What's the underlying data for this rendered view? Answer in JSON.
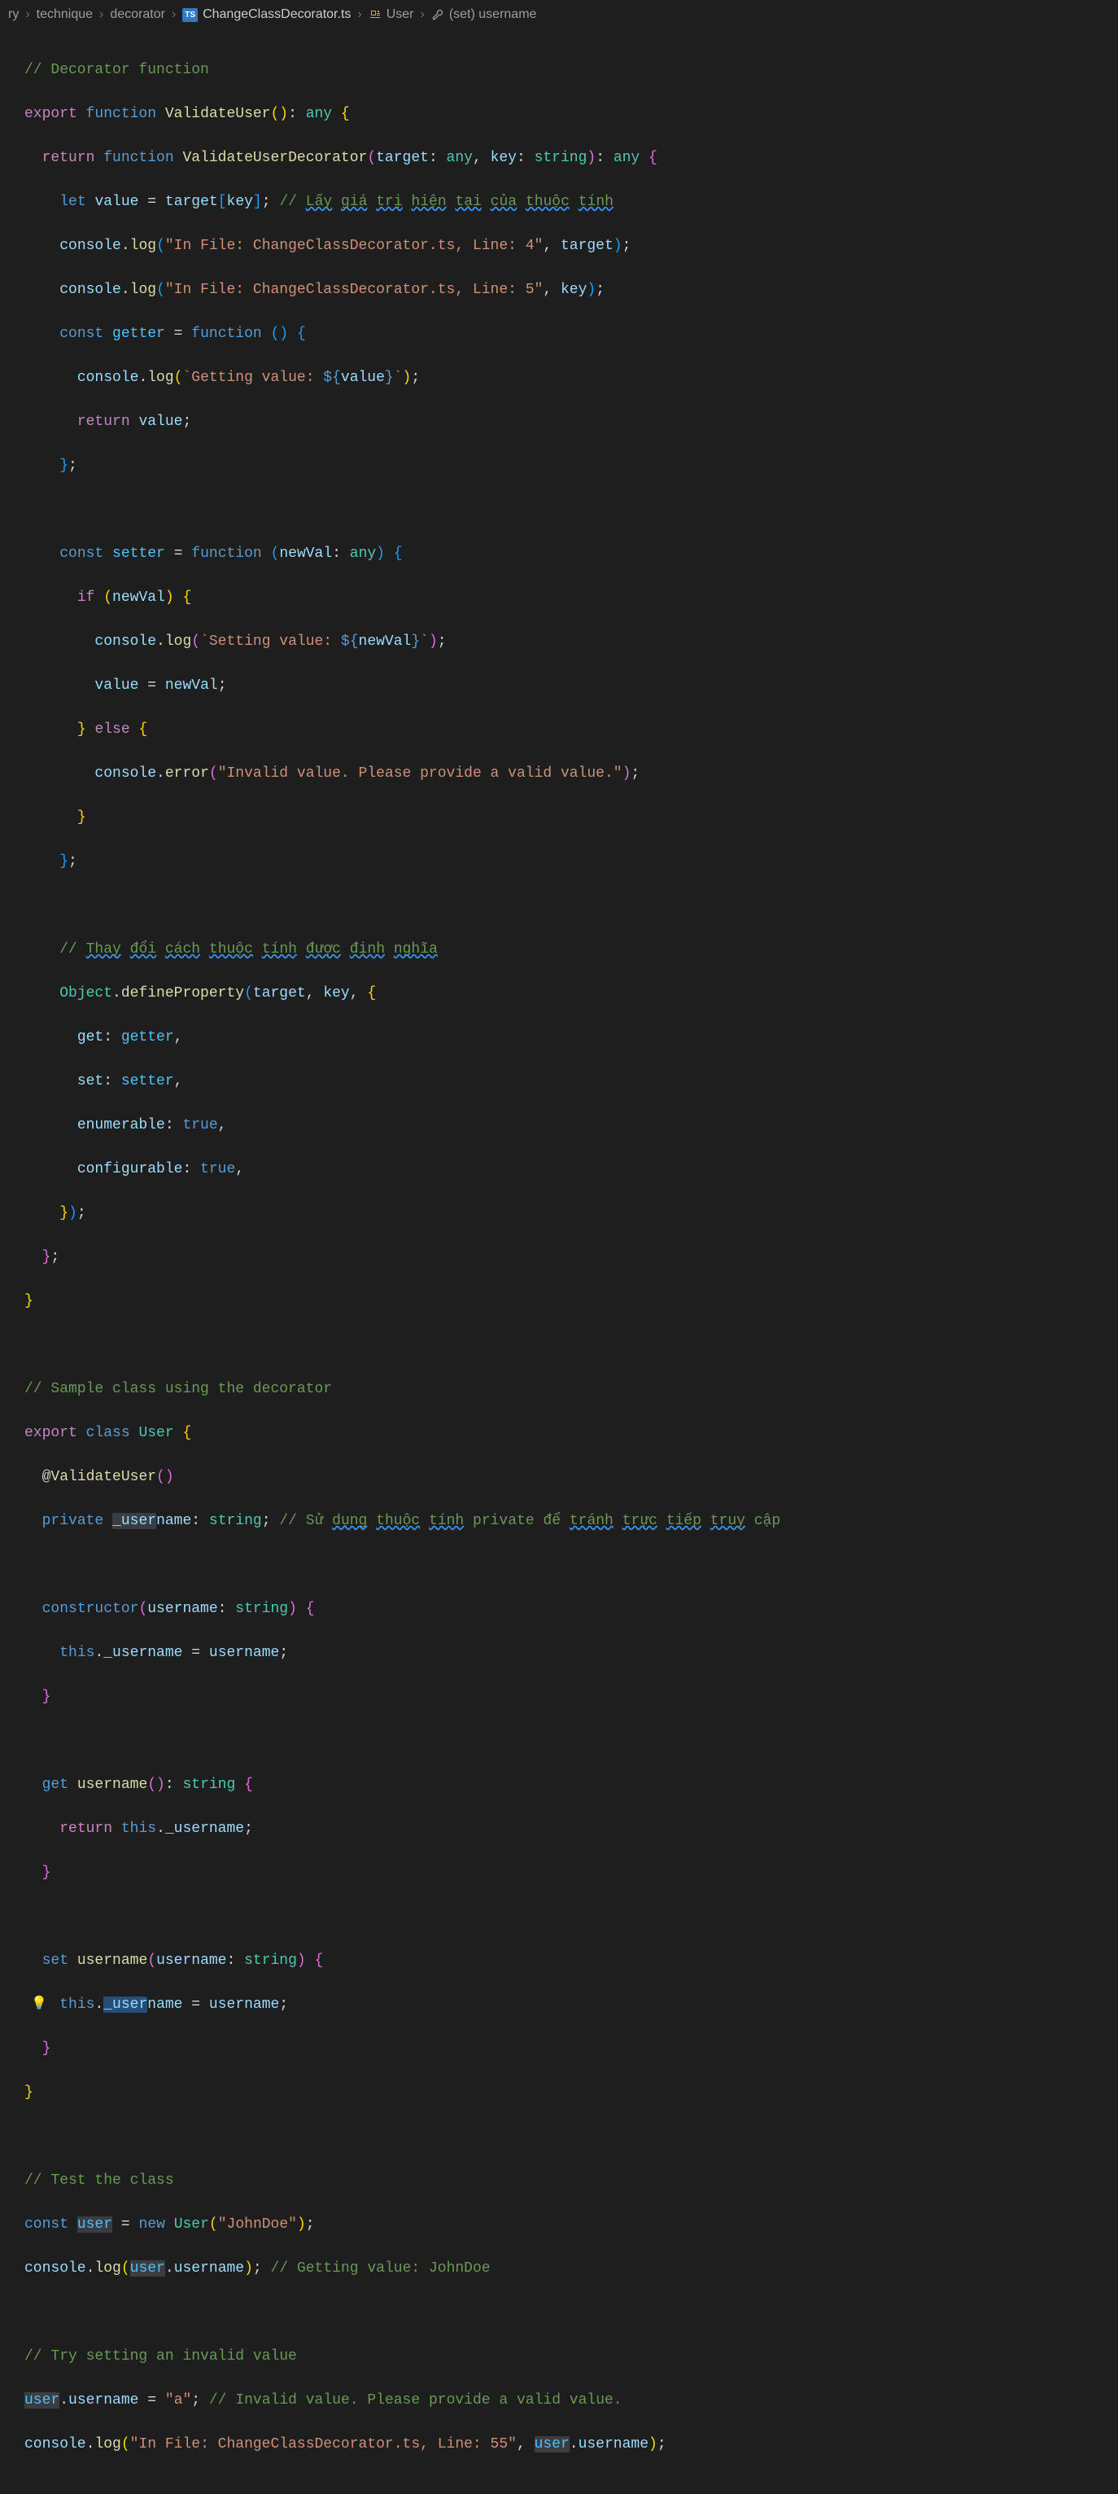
{
  "breadcrumb": {
    "s0": "ry",
    "s1": "technique",
    "s2": "decorator",
    "s3_file": "ChangeClassDecorator.ts",
    "s4": "User",
    "s5": "(set) username"
  },
  "code": {
    "l1_comment": "// Decorator function",
    "l2_export": "export",
    "l2_function": "function",
    "l2_name": "ValidateUser",
    "l2_type": "any",
    "l3_return": "return",
    "l3_function": "function",
    "l3_name": "ValidateUserDecorator",
    "l3_p1": "target",
    "l3_p1t": "any",
    "l3_p2": "key",
    "l3_p2t": "string",
    "l3_rt": "any",
    "l4_let": "let",
    "l4_value": "value",
    "l4_target": "target",
    "l4_key": "key",
    "l4_comment": "// Lấy giá trị hiện tại của thuộc tính",
    "l4_c_lay": "Lấy",
    "l4_c_gia": "giá",
    "l4_c_tri": "trị",
    "l4_c_hien": "hiện",
    "l4_c_tai": "tại",
    "l4_c_cua": "của",
    "l4_c_thuoc": "thuộc",
    "l4_c_tinh": "tính",
    "l5_console": "console",
    "l5_log": "log",
    "l5_str": "\"In File: ChangeClassDecorator.ts, Line: 4\"",
    "l5_target": "target",
    "l6_str": "\"In File: ChangeClassDecorator.ts, Line: 5\"",
    "l6_key": "key",
    "l7_const": "const",
    "l7_getter": "getter",
    "l7_function": "function",
    "l8_console": "console",
    "l8_log": "log",
    "l8_str_a": "`Getting value: ",
    "l8_value": "value",
    "l8_str_b": "`",
    "l9_return": "return",
    "l9_value": "value",
    "l11_const": "const",
    "l11_setter": "setter",
    "l11_function": "function",
    "l11_newVal": "newVal",
    "l11_type": "any",
    "l12_if": "if",
    "l12_newVal": "newVal",
    "l13_str_a": "`Setting value: ",
    "l13_newVal": "newVal",
    "l13_str_b": "`",
    "l14_value": "value",
    "l14_newVal": "newVal",
    "l15_else": "else",
    "l16_error": "error",
    "l16_str": "\"Invalid value. Please provide a valid value.\"",
    "l20_comment": "// Thay đổi cách thuộc tính được định nghĩa",
    "l20_c_thay": "Thay",
    "l20_c_doi": "đổi",
    "l20_c_cach": "cách",
    "l20_c_thuoc": "thuộc",
    "l20_c_tinh": "tính",
    "l20_c_duoc": "được",
    "l20_c_dinh": "định",
    "l20_c_nghia": "nghĩa",
    "l21_Object": "Object",
    "l21_defineProperty": "defineProperty",
    "l21_target": "target",
    "l21_key": "key",
    "l22_get": "get",
    "l22_getter": "getter",
    "l23_set": "set",
    "l23_setter": "setter",
    "l24_enumerable": "enumerable",
    "l24_true": "true",
    "l25_configurable": "configurable",
    "l25_true": "true",
    "l30_comment": "// Sample class using the decorator",
    "l31_export": "export",
    "l31_class": "class",
    "l31_User": "User",
    "l32_at": "@",
    "l32_ValidateUser": "ValidateUser",
    "l33_private": "private",
    "l33_username": "_username",
    "l33_string": "string",
    "l33_comment_pre": "// Sử ",
    "l33_c_dung": "dụng",
    "l33_c_thuoc": "thuộc",
    "l33_c_tinh": "tính",
    "l33_c_mid": " private để ",
    "l33_c_tranh": "tránh",
    "l33_c_truc": "trực",
    "l33_c_tiep": "tiếp",
    "l33_c_truy": "truy",
    "l33_c_cap": " cập",
    "l35_constructor": "constructor",
    "l35_username": "username",
    "l35_string": "string",
    "l36_this": "this",
    "l36_username": "_username",
    "l36_username2": "username",
    "l38_get": "get",
    "l38_username": "username",
    "l38_string": "string",
    "l39_return": "return",
    "l39_this": "this",
    "l39_username": "_username",
    "l41_set": "set",
    "l41_username": "username",
    "l41_param": "username",
    "l41_string": "string",
    "l42_this": "this",
    "l42_username": "_username",
    "l42_username2": "username",
    "l45_comment": "// Test the class",
    "l46_const": "const",
    "l46_user": "user",
    "l46_new": "new",
    "l46_User": "User",
    "l46_str": "\"JohnDoe\"",
    "l47_console": "console",
    "l47_log": "log",
    "l47_user": "user",
    "l47_username": "username",
    "l47_comment": "// Getting value: JohnDoe",
    "l49_comment": "// Try setting an invalid value",
    "l50_user": "user",
    "l50_username": "username",
    "l50_str": "\"a\"",
    "l50_comment": "// Invalid value. Please provide a valid value.",
    "l51_str": "\"In File: ChangeClassDecorator.ts, Line: 55\"",
    "l51_user": "user",
    "l51_username": "username"
  }
}
